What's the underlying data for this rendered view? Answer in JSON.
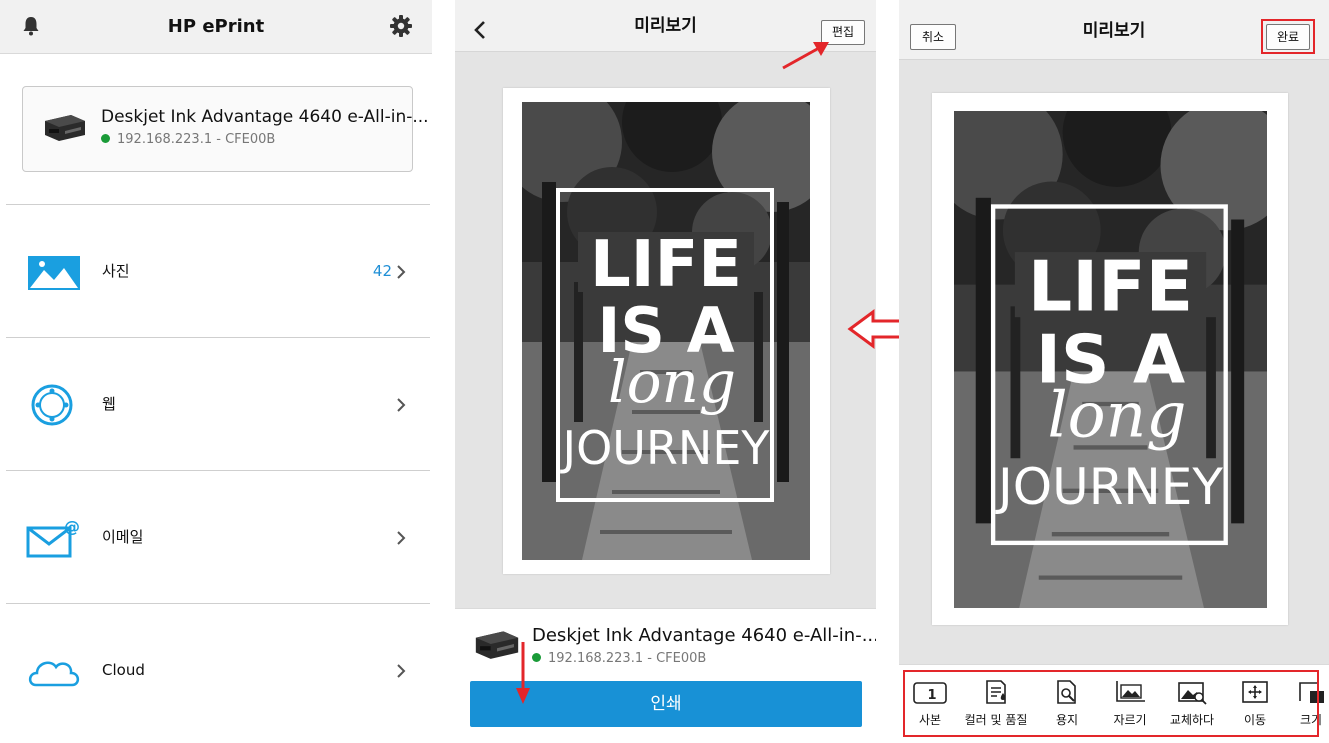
{
  "home": {
    "title": "HP ePrint",
    "device": {
      "name": "Deskjet Ink Advantage 4640 e-All-in-...",
      "status": "192.168.223.1 - CFE00B"
    },
    "menu": [
      {
        "label": "사진",
        "count": "42",
        "icon": "photo-icon"
      },
      {
        "label": "웹",
        "icon": "web-globe-icon"
      },
      {
        "label": "이메일",
        "icon": "email-icon"
      },
      {
        "label": "Cloud",
        "icon": "cloud-icon"
      }
    ]
  },
  "preview": {
    "title": "미리보기",
    "edit_label": "편집",
    "poster_lines": [
      "LIFE",
      "IS A",
      "long",
      "JOURNEY"
    ],
    "device": {
      "name": "Deskjet Ink Advantage 4640 e-All-in-...",
      "status": "192.168.223.1 - CFE00B"
    },
    "print_label": "인쇄"
  },
  "edit": {
    "title": "미리보기",
    "cancel_label": "취소",
    "done_label": "완료",
    "tools": [
      {
        "label": "사본",
        "icon": "copies-icon",
        "badge": "1"
      },
      {
        "label": "컬러 및 품질",
        "icon": "color-quality-icon"
      },
      {
        "label": "용지",
        "icon": "paper-icon"
      },
      {
        "label": "자르기",
        "icon": "crop-icon"
      },
      {
        "label": "교체하다",
        "icon": "replace-icon"
      },
      {
        "label": "이동",
        "icon": "move-icon"
      },
      {
        "label": "크기",
        "icon": "resize-icon"
      }
    ]
  },
  "colors": {
    "accent": "#1891d6",
    "status_online": "#1a9b38",
    "annotation": "#e3262a"
  }
}
